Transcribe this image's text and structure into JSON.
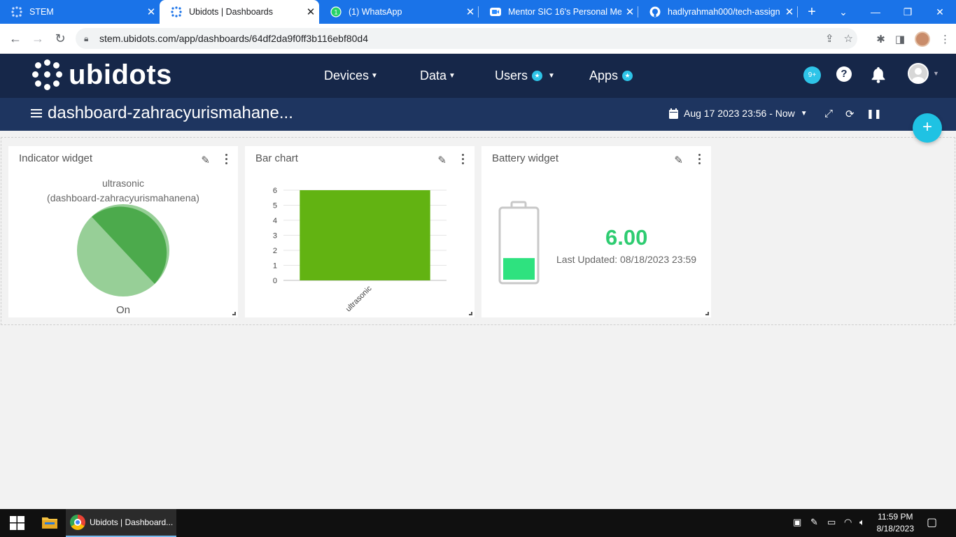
{
  "browser": {
    "tabs": [
      {
        "title": "STEM",
        "active": false
      },
      {
        "title": "Ubidots | Dashboards",
        "active": true
      },
      {
        "title": "(1) WhatsApp",
        "active": false
      },
      {
        "title": "Mentor SIC 16's Personal Me",
        "active": false
      },
      {
        "title": "hadlyrahmah000/tech-assign",
        "active": false
      }
    ],
    "new_tab": "+",
    "url": "stem.ubidots.com/app/dashboards/64df2da9f0ff3b116ebf80d4"
  },
  "app": {
    "logo_text": "ubidots",
    "nav": [
      {
        "label": "Devices",
        "star": false
      },
      {
        "label": "Data",
        "star": false
      },
      {
        "label": "Users",
        "star": true
      },
      {
        "label": "Apps",
        "star": true
      }
    ],
    "notifications_badge": "9+",
    "help": "?"
  },
  "dashboard": {
    "title": "dashboard-zahracyurismahane...",
    "date_range": "Aug 17 2023 23:56 - Now",
    "add_button": "+"
  },
  "widgets": {
    "indicator": {
      "title": "Indicator widget",
      "variable": "ultrasonic",
      "device": "(dashboard-zahracyurismahanena)",
      "state": "On",
      "colors": {
        "light": "#97cf97",
        "dark": "#4caa4c"
      }
    },
    "bar": {
      "title": "Bar chart"
    },
    "battery": {
      "title": "Battery widget",
      "value": "6.00",
      "last_updated": "Last Updated: 08/18/2023 23:59",
      "level": 0.3,
      "color": "#2ee27f"
    }
  },
  "chart_data": {
    "type": "bar",
    "categories": [
      "ultrasonic"
    ],
    "values": [
      6
    ],
    "ylim": [
      0,
      6
    ],
    "yticks": [
      "0",
      "1",
      "2",
      "3",
      "4",
      "5",
      "6"
    ],
    "color": "#62b312",
    "grid": true
  },
  "taskbar": {
    "task_label": "Ubidots | Dashboard...",
    "time": "11:59 PM",
    "date": "8/18/2023"
  }
}
